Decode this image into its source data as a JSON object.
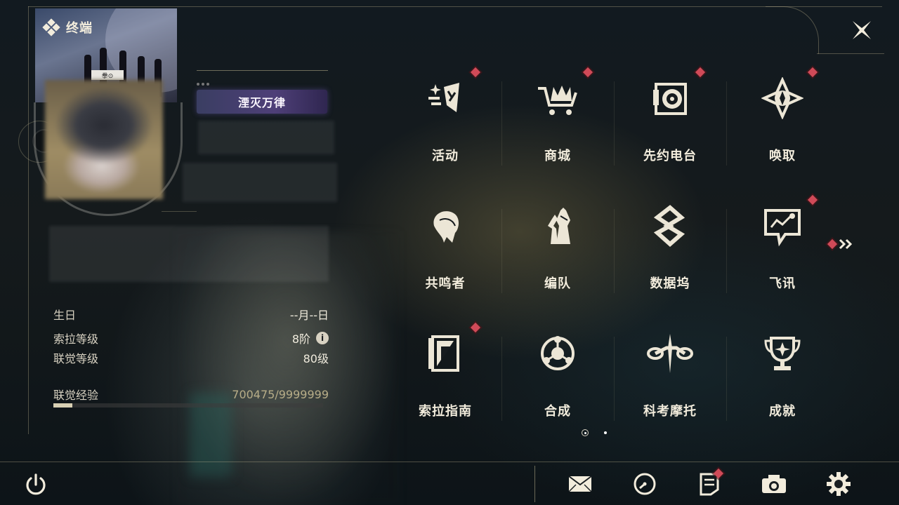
{
  "header": {
    "title": "终端",
    "logo_icon": "terminal-diamond-icon",
    "close_icon": "close-x-icon"
  },
  "profile": {
    "card_badge": "拳⊙",
    "title_badge": "湮灭万律",
    "stats": [
      {
        "label": "生日",
        "value": "--月--日"
      },
      {
        "label": "索拉等级",
        "value": "8阶",
        "info": "i"
      },
      {
        "label": "联觉等级",
        "value": "80级"
      }
    ],
    "experience": {
      "label": "联觉经验",
      "value": "700475/9999999",
      "fraction": 0.07
    }
  },
  "menu": {
    "items": [
      {
        "label": "活动",
        "icon": "activity-icon",
        "badge": true
      },
      {
        "label": "商城",
        "icon": "shop-cart-icon",
        "badge": true
      },
      {
        "label": "先约电台",
        "icon": "radio-icon",
        "badge": true
      },
      {
        "label": "唤取",
        "icon": "convene-icon",
        "badge": true
      },
      {
        "label": "共鸣者",
        "icon": "resonator-icon",
        "badge": false
      },
      {
        "label": "编队",
        "icon": "chess-team-icon",
        "badge": false
      },
      {
        "label": "数据坞",
        "icon": "databank-icon",
        "badge": false
      },
      {
        "label": "飞讯",
        "icon": "message-icon",
        "badge": true
      },
      {
        "label": "索拉指南",
        "icon": "guidebook-icon",
        "badge": true
      },
      {
        "label": "合成",
        "icon": "synthesis-icon",
        "badge": false
      },
      {
        "label": "科考摩托",
        "icon": "motorbike-icon",
        "badge": false
      },
      {
        "label": "成就",
        "icon": "trophy-icon",
        "badge": false
      }
    ],
    "next_icon": "double-chevron-right-icon",
    "pages": {
      "current": 1,
      "total": 2
    }
  },
  "bottom": {
    "power_icon": "power-icon",
    "icons": [
      {
        "name": "mail-icon",
        "badge": false
      },
      {
        "name": "clock-icon",
        "badge": false
      },
      {
        "name": "notice-icon",
        "badge": true
      },
      {
        "name": "camera-icon",
        "badge": false
      },
      {
        "name": "gear-icon",
        "badge": false
      }
    ]
  },
  "colors": {
    "badge_red": "#d04a58",
    "text": "#f2ecdc",
    "frame": "#c8be96"
  }
}
